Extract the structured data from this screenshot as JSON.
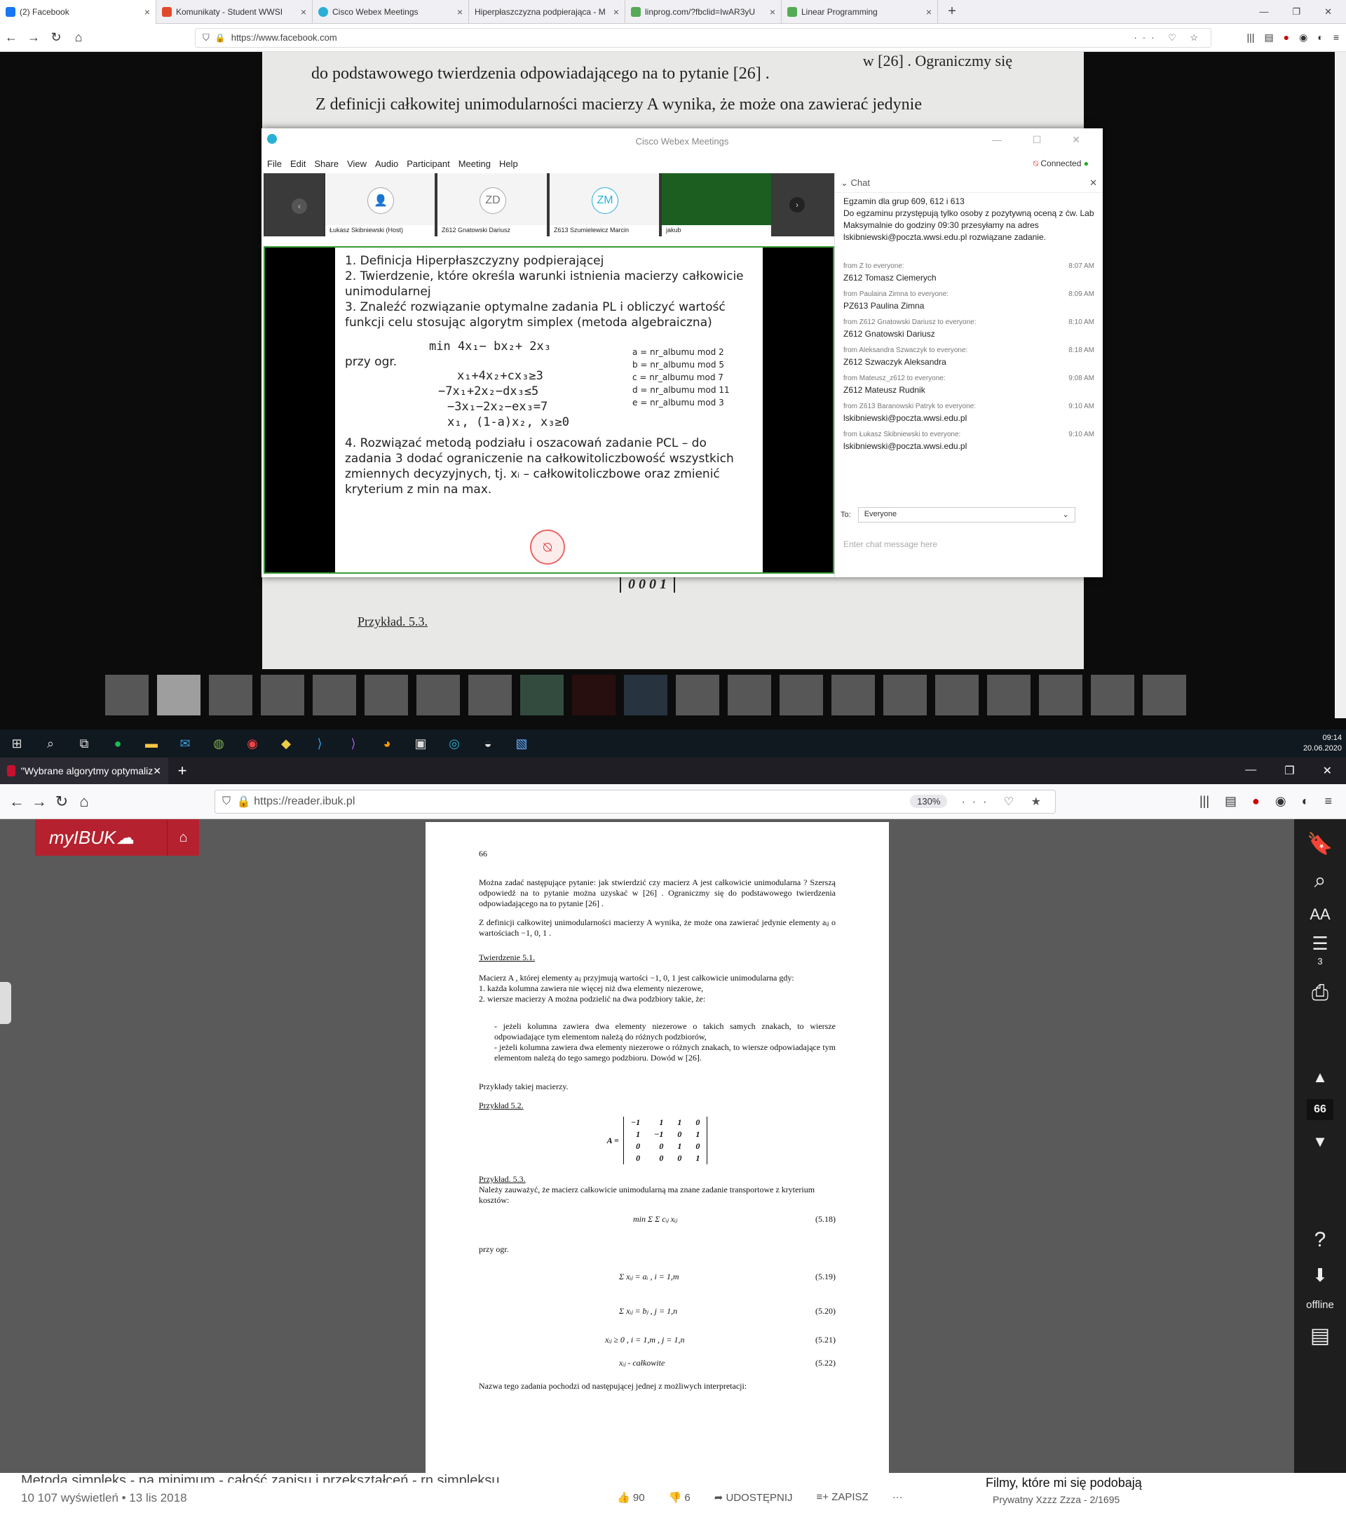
{
  "top_browser": {
    "tabs": [
      {
        "label": "(2) Facebook",
        "color": "#1877f2"
      },
      {
        "label": "Komunikaty - Student WWSI",
        "color": "#e04a2a"
      },
      {
        "label": "Cisco Webex Meetings",
        "color": "#2ab0d6"
      },
      {
        "label": "Hiperpłaszczyzna podpierająca - M",
        "color": "#888"
      },
      {
        "label": "linprog.com/?fbclid=IwAR3yU",
        "color": "#5a5"
      },
      {
        "label": "Linear Programming",
        "color": "#5a5"
      }
    ],
    "url": "https://www.facebook.com"
  },
  "background_text": {
    "l1": "do podstawowego twierdzenia odpowiadającego na to pytanie  [26] .",
    "l0": "w [26] . Ograniczmy się",
    "l2": "Z definicji całkowitej unimodularności macierzy  A  wynika, że może ona zawierać jedynie",
    "mat": "0  0  0  1",
    "ex": "Przykład. 5.3."
  },
  "webex": {
    "title": "Cisco Webex Meetings",
    "menu": [
      "File",
      "Edit",
      "Share",
      "View",
      "Audio",
      "Participant",
      "Meeting",
      "Help"
    ],
    "connected": "Connected",
    "participants": [
      {
        "name": "Łukasz Skibniewski (Host)",
        "initials": "👤"
      },
      {
        "name": "Z612 Gnatowski Dariusz",
        "initials": "ZD"
      },
      {
        "name": "Z613 Szumielewicz Marcin",
        "initials": "ZM"
      },
      {
        "name": "jakub",
        "initials": ""
      }
    ],
    "slide": {
      "p1": "1. Definicja Hiperpłaszczyzny podpierającej",
      "p2": "2. Twierdzenie, które określa warunki istnienia macierzy całkowicie unimodularnej",
      "p3": "3. Znaleźć rozwiązanie optymalne zadania PL i obliczyć wartość funkcji celu stosując algorytm simplex (metoda algebraiczna)",
      "obj": "min 4x₁− bx₂+ 2x₃",
      "przy": "przy ogr.",
      "c1": "x₁+4x₂+cx₃≥3",
      "c2": "−7x₁+2x₂−dx₃≤5",
      "c3": "−3x₁−2x₂−ex₃=7",
      "c4": "x₁, (1-a)x₂, x₃≥0",
      "a": "a = nr_albumu mod 2",
      "b": "b = nr_albumu mod 5",
      "c": "c = nr_albumu mod 7",
      "d": "d = nr_albumu mod 11",
      "e": "e = nr_albumu mod 3",
      "p4": "4. Rozwiązać metodą podziału i oszacowań zadanie PCL – do zadania 3 dodać ograniczenie na całkowitoliczbowość wszystkich zmiennych decyzyjnych, tj. xᵢ – całkowitoliczbowe oraz zmienić kryterium z min na max."
    },
    "chat": {
      "title": "Chat",
      "intro": [
        "Egzamin dla grup 609, 612 i 613",
        "Do egzaminu przystępują tylko osoby z pozytywną oceną z ćw. Lab",
        "Maksymalnie do godziny 09:30 przesyłamy na adres lskibniewski@poczta.wwsi.edu.pl rozwiązane zadanie."
      ],
      "messages": [
        {
          "from": "from Z to everyone:",
          "time": "8:07 AM",
          "text": "Z612 Tomasz Ciemerych"
        },
        {
          "from": "from Paulaina Zimna to everyone:",
          "time": "8:09 AM",
          "text": "PZ613 Paulina Zimna"
        },
        {
          "from": "from Z612 Gnatowski Dariusz to everyone:",
          "time": "8:10 AM",
          "text": "Z612 Gnatowski Dariusz"
        },
        {
          "from": "from Aleksandra Szwaczyk to everyone:",
          "time": "8:18 AM",
          "text": "Z612 Szwaczyk Aleksandra"
        },
        {
          "from": "from Mateusz_z612 to everyone:",
          "time": "9:08 AM",
          "text": "Z612 Mateusz Rudnik"
        },
        {
          "from": "from Z613 Baranowski Patryk to everyone:",
          "time": "9:10 AM",
          "text": "lskibniewski@poczta.wwsi.edu.pl"
        },
        {
          "from": "from Łukasz Skibniewski to everyone:",
          "time": "9:10 AM",
          "text": "lskibniewski@poczta.wwsi.edu.pl"
        }
      ],
      "to_label": "To:",
      "to_value": "Everyone",
      "placeholder": "Enter chat message here"
    }
  },
  "taskbar": {
    "time": "09:14",
    "date": "20.06.2020"
  },
  "bottom_browser": {
    "tab": "\"Wybrane algorytmy optymaliz",
    "url": "https://reader.ibuk.pl",
    "zoom": "130%",
    "brand": "myIBUK",
    "page_no": "66",
    "side_toc": "3",
    "offline": "offline"
  },
  "book": {
    "num": "66",
    "para1": "Można zadać następujące pytanie: jak stwierdzić czy macierz  A jest całkowicie unimodularna ?  Szerszą odpowiedź na to pytanie można uzyskać   w [26] . Ograniczmy się do podstawowego twierdzenia odpowiadającego na to pytanie  [26] .",
    "para2": "Z definicji całkowitej unimodularności macierzy  A wynika, że może ona zawierać jedynie elementy  aᵢⱼ  o wartościach  −1, 0, 1 .",
    "thm": "Twierdzenie 5.1.",
    "thm_text": "Macierz A , której elementy  aᵢⱼ  przyjmują wartości  −1, 0, 1  jest całkowicie unimodularna gdy:",
    "i1": "1.   każda kolumna zawiera nie więcej niż dwa elementy niezerowe,",
    "i2": "2.   wiersze macierzy  A  można podzielić na dwa podzbiory takie, że:",
    "d1": "-   jeżeli kolumna zawiera dwa elementy niezerowe o takich samych znakach, to wiersze odpowiadające tym elementom należą do różnych podzbiorów,",
    "d2": "-   jeżeli kolumna zawiera dwa elementy niezerowe o różnych znakach, to wiersze odpowiadające tym elementom należą do tego samego podzbioru.    Dowód w [26].",
    "ex_intro": "Przykłady takiej macierzy.",
    "ex1": "Przykład 5.2.",
    "matrix": [
      [
        "−1",
        "1",
        "1",
        "0"
      ],
      [
        "1",
        "−1",
        "0",
        "1"
      ],
      [
        "0",
        "0",
        "1",
        "0"
      ],
      [
        "0",
        "0",
        "0",
        "1"
      ]
    ],
    "ex2": "Przykład. 5.3.",
    "ex2_text": "Należy zauważyć, że macierz całkowicie unimodularną ma znane zadanie transportowe z kryterium kosztów:",
    "f18": "min Σ Σ cᵢⱼ xᵢⱼ",
    "n18": "(5.18)",
    "przy": "przy ogr.",
    "f19": "Σ xᵢⱼ = aᵢ  ,  i = 1,m",
    "n19": "(5.19)",
    "f20": "Σ xᵢⱼ = bⱼ  ,  j = 1,n",
    "n20": "(5.20)",
    "f21": "xᵢⱼ ≥ 0  ,  i = 1,m ,  j = 1,n",
    "n21": "(5.21)",
    "f22": "xᵢⱼ     - całkowite",
    "n22": "(5.22)",
    "last": "Nazwa tego zadania pochodzi od następującej jednej z możliwych interpretacji:"
  },
  "youtube": {
    "title": "Metoda simpleks - na minimum - całość zapisu i przekształceń - rn simpleksu",
    "views": "10 107 wyświetleń • 13 lis 2018",
    "likes": "90",
    "dislikes": "6",
    "share": "UDOSTĘPNIJ",
    "save": "ZAPISZ",
    "playlist": "Filmy, które mi się podobają",
    "playlist_sub": "Prywatny   Xzzz Zzza - 2/1695"
  }
}
